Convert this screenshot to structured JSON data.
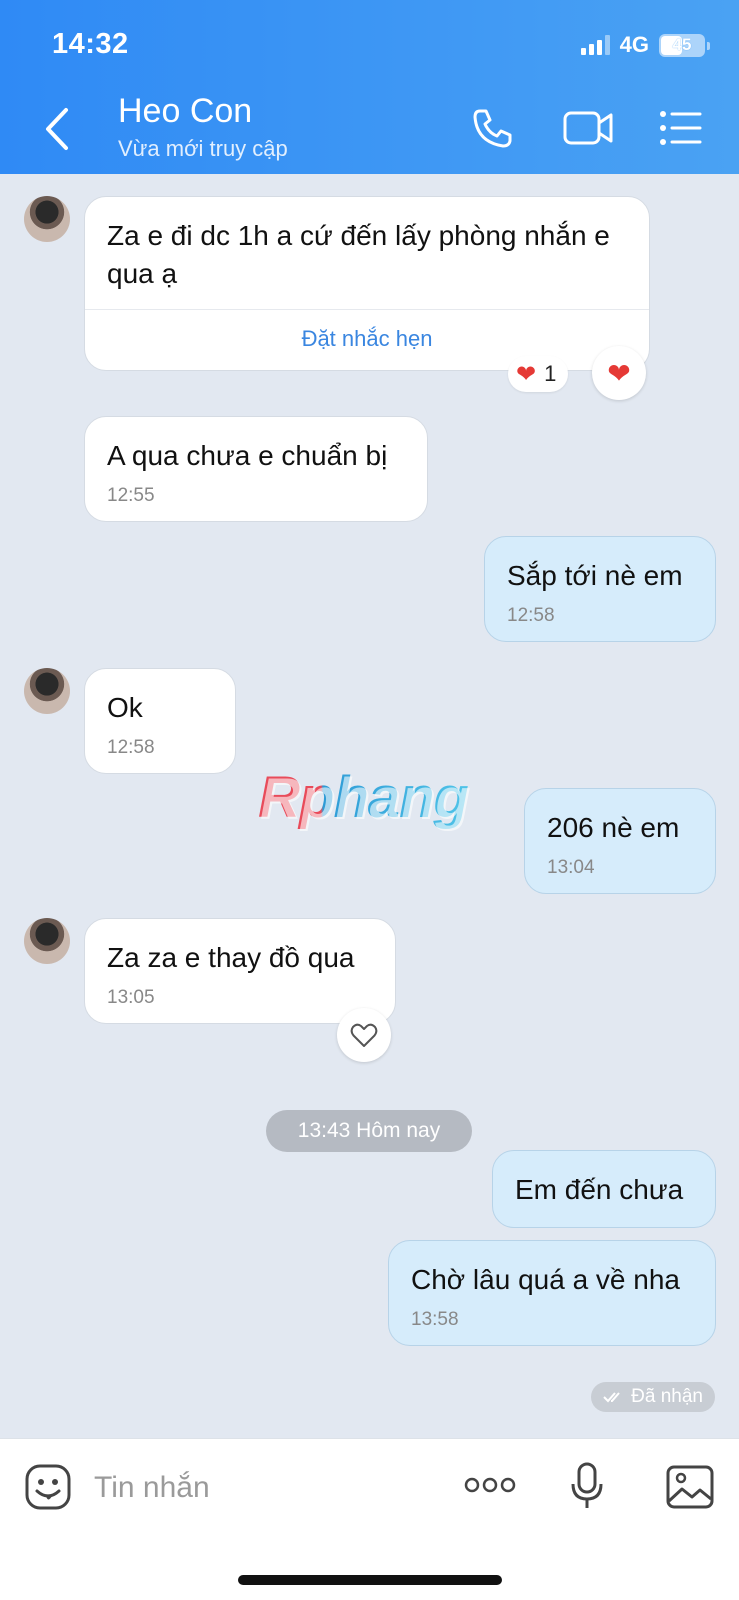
{
  "status_bar": {
    "time": "14:32",
    "network": "4G",
    "battery": "45"
  },
  "header": {
    "contact_name": "Heo Con",
    "contact_status": "Vừa mới truy cập"
  },
  "messages": [
    {
      "text": "Za e đi dc 1h a cứ đến lấy phòng nhắn e qua ạ",
      "action": "Đặt nhắc hẹn",
      "reaction_count": "1"
    },
    {
      "text": "A qua chưa e chuẩn bị",
      "time": "12:55"
    },
    {
      "text": "Sắp tới nè em",
      "time": "12:58"
    },
    {
      "text": "Ok",
      "time": "12:58"
    },
    {
      "text": "206 nè em",
      "time": "13:04"
    },
    {
      "text": "Za za e thay đồ qua",
      "time": "13:05"
    },
    {
      "text": "Em đến chưa"
    },
    {
      "text": "Chờ lâu quá a về nha",
      "time": "13:58"
    }
  ],
  "date_separator": "13:43 Hôm nay",
  "delivery_status": "Đã nhận",
  "watermark": "Rphang",
  "composer": {
    "placeholder": "Tin nhắn"
  },
  "colors": {
    "header": "#2f8af5",
    "outgoing_bubble": "#d6ecfb",
    "incoming_bubble": "#ffffff",
    "background": "#e2e8f1",
    "link": "#3a86e0"
  }
}
